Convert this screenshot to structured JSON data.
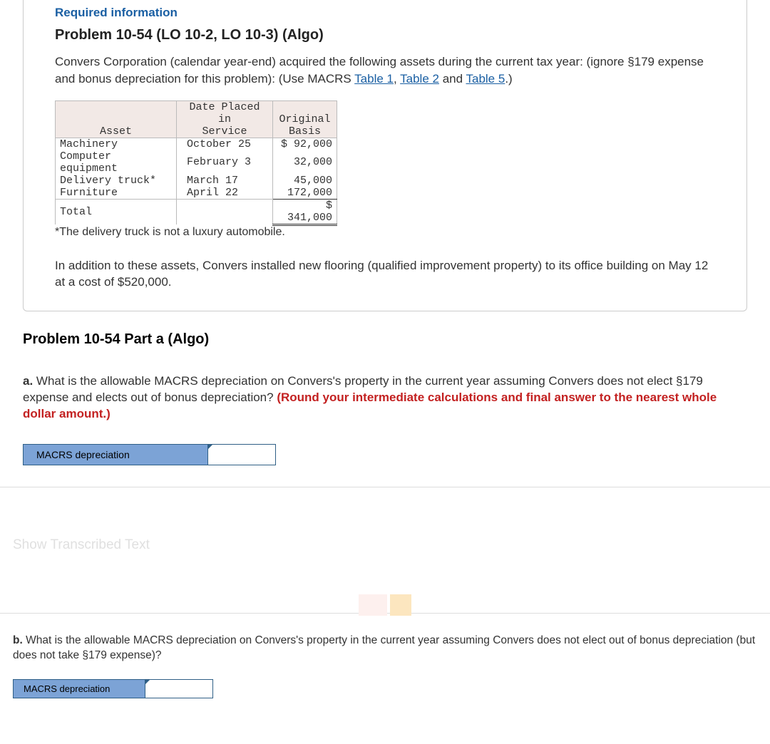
{
  "info": {
    "required": "Required information",
    "title": "Problem 10-54 (LO 10-2, LO 10-3) (Algo)",
    "intro_pre": "Convers Corporation (calendar year-end) acquired the following assets during the current tax year: (ignore §179 expense and bonus depreciation for this problem): (Use MACRS ",
    "table1": "Table 1",
    "sep1": ", ",
    "table2": "Table 2",
    "sep2": " and ",
    "table5": "Table 5",
    "intro_post": ".)",
    "table": {
      "headers": {
        "asset": "Asset",
        "date_l1": "Date Placed in",
        "date_l2": "Service",
        "basis_l1": "Original",
        "basis_l2": "Basis"
      },
      "rows": [
        {
          "asset": "Machinery",
          "date": "October 25",
          "basis": "$ 92,000"
        },
        {
          "asset": "Computer equipment",
          "date": "February 3",
          "basis": "32,000"
        },
        {
          "asset": "Delivery truck*",
          "date": "March 17",
          "basis": "45,000"
        },
        {
          "asset": "Furniture",
          "date": "April 22",
          "basis": "172,000"
        }
      ],
      "total_label": "Total",
      "total_basis": "$ 341,000"
    },
    "footnote": "*The delivery truck is not a luxury automobile.",
    "addition": "In addition to these assets, Convers installed new flooring (qualified improvement property) to its office building on May 12 at a cost of $520,000."
  },
  "part": {
    "header": "Problem 10-54 Part a (Algo)",
    "qa_bold": "a.",
    "qa_text": " What is the allowable MACRS depreciation on Convers's property in the current year assuming Convers does not elect §179 expense and elects out of bonus depreciation? ",
    "qa_round": "(Round your intermediate calculations and final answer to the nearest whole dollar amount.)",
    "answer_label": "MACRS depreciation"
  },
  "transcribed": "Show Transcribed Text",
  "part_b": {
    "qb_bold": "b.",
    "qb_text": " What is the allowable MACRS depreciation on Convers's property in the current year assuming Convers does not elect out of bonus depreciation (but does not take §179 expense)?",
    "answer_label": "MACRS depreciation"
  },
  "chart_data": {
    "type": "table",
    "title": "Assets acquired by Convers Corporation",
    "columns": [
      "Asset",
      "Date Placed in Service",
      "Original Basis"
    ],
    "rows": [
      [
        "Machinery",
        "October 25",
        92000
      ],
      [
        "Computer equipment",
        "February 3",
        32000
      ],
      [
        "Delivery truck*",
        "March 17",
        45000
      ],
      [
        "Furniture",
        "April 22",
        172000
      ]
    ],
    "total": 341000,
    "additional_asset": {
      "description": "Qualified improvement property (flooring)",
      "date": "May 12",
      "cost": 520000
    }
  }
}
